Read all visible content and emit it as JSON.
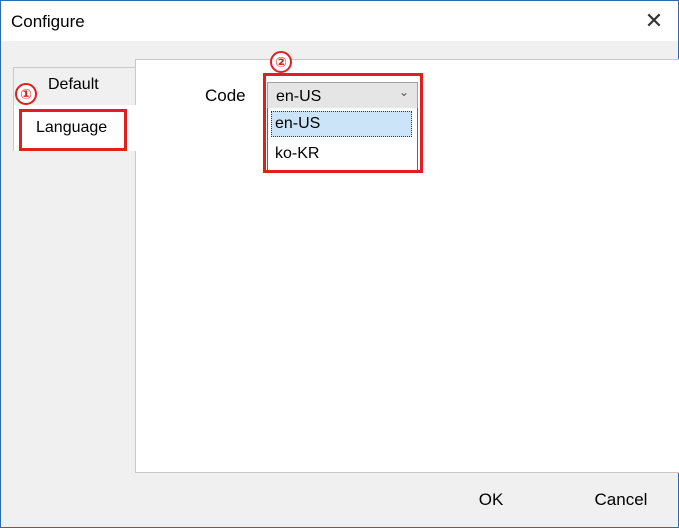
{
  "window": {
    "title": "Configure",
    "close_symbol": "✕"
  },
  "tabs": [
    {
      "label": "Default",
      "selected": false
    },
    {
      "label": "Language",
      "selected": true
    }
  ],
  "language_panel": {
    "code_label": "Code",
    "combo_value": "en-US",
    "combo_arrow": "⌄",
    "options": [
      "en-US",
      "ko-KR"
    ],
    "highlighted_option": "en-US"
  },
  "annotations": {
    "marker_1": "①",
    "marker_2": "②",
    "color": "#e02020"
  },
  "footer": {
    "ok_label": "OK",
    "cancel_label": "Cancel"
  }
}
